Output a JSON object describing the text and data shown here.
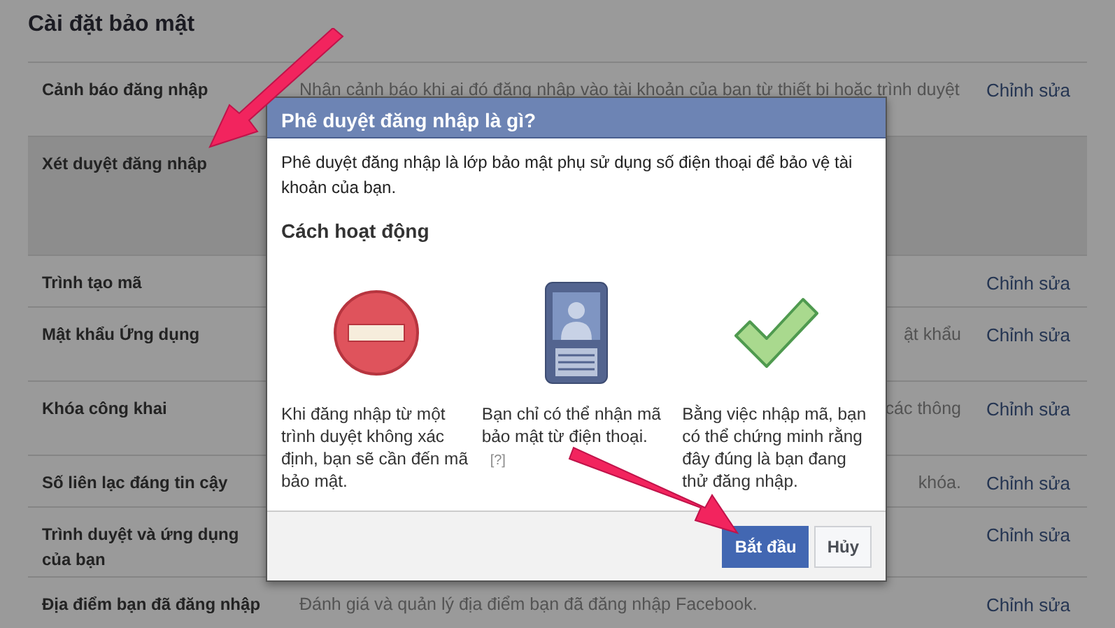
{
  "page": {
    "title": "Cài đặt bảo mật"
  },
  "settings": [
    {
      "label": "Cảnh báo đăng nhập",
      "description": "Nhận cảnh báo khi ai đó đăng nhập vào tài khoản của bạn từ thiết bị hoặc trình duyệt",
      "edit": "Chỉnh sửa",
      "selected": false
    },
    {
      "label": "Xét duyệt đăng nhập",
      "selected": true
    },
    {
      "label": "Trình tạo mã",
      "edit": "Chỉnh sửa",
      "selected": false
    },
    {
      "label": "Mật khẩu Ứng dụng",
      "description": "ật khẩu",
      "edit": "Chỉnh sửa",
      "selected": false
    },
    {
      "label": "Khóa công khai",
      "description": "các thông",
      "edit": "Chỉnh sửa",
      "selected": false
    },
    {
      "label": "Số liên lạc đáng tin cậy",
      "description": "khóa.",
      "edit": "Chỉnh sửa",
      "selected": false
    },
    {
      "label": "Trình duyệt và ứng dụng của bạn",
      "edit": "Chỉnh sửa",
      "selected": false
    },
    {
      "label": "Địa điểm bạn đã đăng nhập",
      "description": "Đánh giá và quản lý địa điểm bạn đã đăng nhập Facebook.",
      "edit": "Chỉnh sửa",
      "selected": false
    }
  ],
  "dialog": {
    "title": "Phê duyệt đăng nhập là gì?",
    "intro": "Phê duyệt đăng nhập là lớp bảo mật phụ sử dụng số điện thoại để bảo vệ tài khoản của bạn.",
    "section_heading": "Cách hoạt động",
    "steps": [
      {
        "kind": "blocked",
        "text": "Khi đăng nhập từ một trình duyệt không xác định, bạn sẽ cần đến mã bảo mật."
      },
      {
        "kind": "phone",
        "text": "Bạn chỉ có thể nhận mã bảo mật từ điện thoại.",
        "help": "[?]"
      },
      {
        "kind": "check",
        "text": "Bằng việc nhập mã, bạn có thể chứng minh rằng đây đúng là bạn đang thử đăng nhập."
      }
    ],
    "buttons": [
      {
        "label": "Bắt đầu",
        "kind": "primary"
      },
      {
        "label": "Hủy",
        "kind": "secondary"
      }
    ]
  }
}
